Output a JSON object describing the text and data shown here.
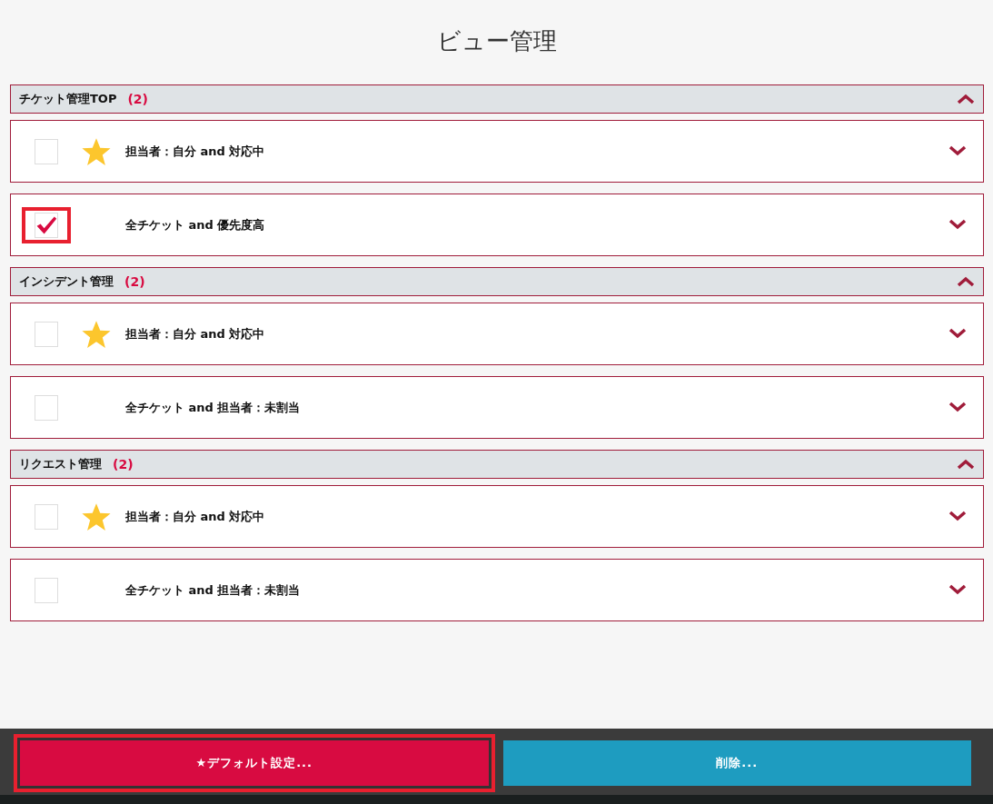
{
  "title": "ビュー管理",
  "groups": [
    {
      "name": "チケット管理TOP",
      "count": "(2)",
      "expanded": true,
      "views": [
        {
          "label": "担当者：自分 and 対応中",
          "checked": false,
          "highlighted": false,
          "is_default": true,
          "expanded": false
        },
        {
          "label": "全チケット and 優先度高",
          "checked": true,
          "highlighted": true,
          "is_default": false,
          "expanded": false
        }
      ]
    },
    {
      "name": "インシデント管理",
      "count": "(2)",
      "expanded": true,
      "views": [
        {
          "label": "担当者：自分 and 対応中",
          "checked": false,
          "highlighted": false,
          "is_default": true,
          "expanded": false
        },
        {
          "label": "全チケット and 担当者：未割当",
          "checked": false,
          "highlighted": false,
          "is_default": false,
          "expanded": false
        }
      ]
    },
    {
      "name": "リクエスト管理",
      "count": "(2)",
      "expanded": true,
      "views": [
        {
          "label": "担当者：自分 and 対応中",
          "checked": false,
          "highlighted": false,
          "is_default": true,
          "expanded": false
        },
        {
          "label": "全チケット and 担当者：未割当",
          "checked": false,
          "highlighted": false,
          "is_default": false,
          "expanded": false
        }
      ]
    }
  ],
  "actions": [
    {
      "label": "★デフォルト設定...",
      "kind": "primary",
      "highlighted": true
    },
    {
      "label": "削除...",
      "kind": "secondary",
      "highlighted": false
    }
  ]
}
